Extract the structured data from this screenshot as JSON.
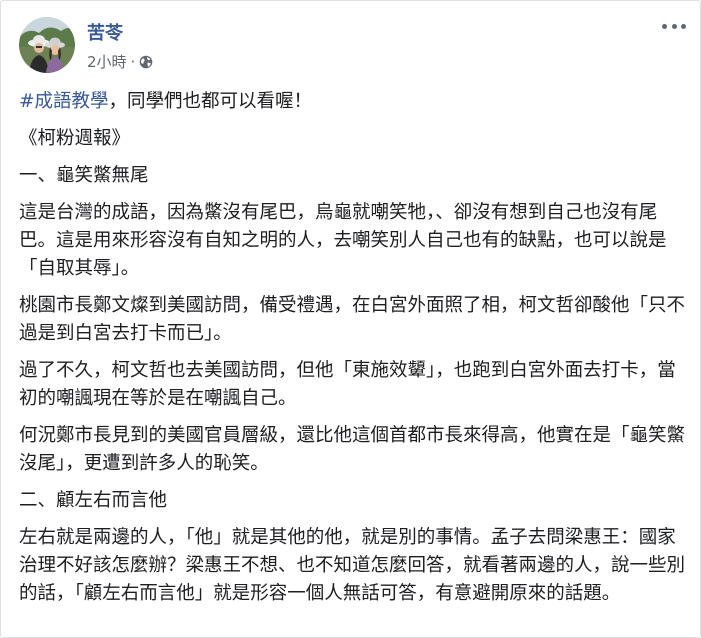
{
  "post": {
    "author": "苦苓",
    "time": "2小時",
    "dot": "·",
    "privacy_icon": "globe-icon",
    "more_icon": "more-options-icon",
    "hashtag": "#成語教學",
    "intro_rest": "，同學們也都可以看喔！",
    "paragraphs": [
      "《柯粉週報》",
      "一、龜笑鱉無尾",
      "這是台灣的成語，因為鱉沒有尾巴，烏龜就嘲笑牠，、卻沒有想到自己也沒有尾巴。這是用來形容沒有自知之明的人，去嘲笑別人自己也有的缺點，也可以說是「自取其辱」。",
      "桃園市長鄭文燦到美國訪問，備受禮遇，在白宮外面照了相，柯文哲卻酸他「只不過是到白宮去打卡而已」。",
      "過了不久，柯文哲也去美國訪問，但他「東施效顰」，也跑到白宮外面去打卡，當初的嘲諷現在等於是在嘲諷自己。",
      "何況鄭市長見到的美國官員層級，還比他這個首都市長來得高，他實在是「龜笑鱉沒尾」，更遭到許多人的恥笑。",
      "二、顧左右而言他",
      "左右就是兩邊的人，「他」就是其他的他，就是別的事情。孟子去問梁惠王：國家治理不好該怎麼辦？梁惠王不想、也不知道怎麼回答，就看著兩邊的人，說一些別的話，「顧左右而言他」就是形容一個人無話可答，有意避開原來的話題。"
    ]
  }
}
